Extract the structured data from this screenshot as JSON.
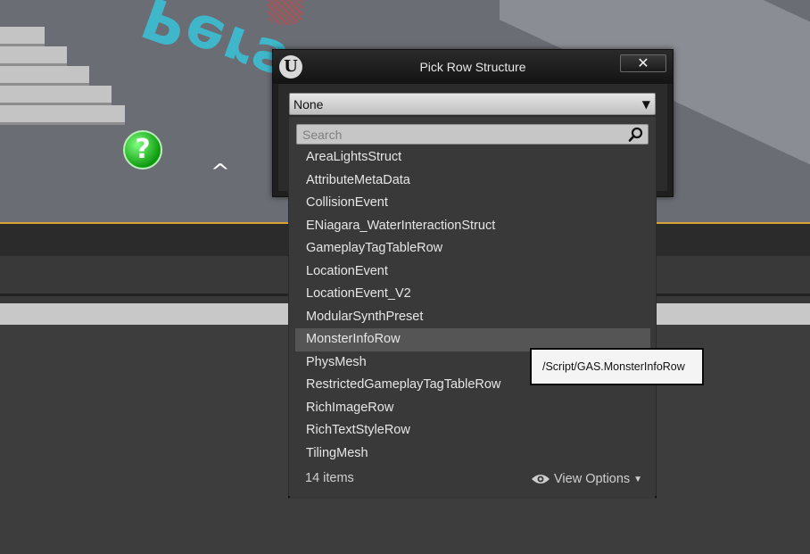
{
  "dialog": {
    "title": "Pick Row Structure",
    "close_label": "✕",
    "logo_label": "U",
    "combo_value": "None",
    "combo_arrow": "▼"
  },
  "viewport": {
    "help_symbol": "?",
    "caret_symbol": "^"
  },
  "search": {
    "placeholder": "Search"
  },
  "list": {
    "items": [
      "AreaLightsStruct",
      "AttributeMetaData",
      "CollisionEvent",
      "ENiagara_WaterInteractionStruct",
      "GameplayTagTableRow",
      "LocationEvent",
      "LocationEvent_V2",
      "ModularSynthPreset",
      "MonsterInfoRow",
      "PhysMesh",
      "RestrictedGameplayTagTableRow",
      "RichImageRow",
      "RichTextStyleRow",
      "TilingMesh"
    ],
    "hovered_index": 8
  },
  "footer": {
    "count": "14 items",
    "view_options": "View Options",
    "view_arrow": "▼"
  },
  "tooltip": {
    "text": "/Script/GAS.MonsterInfoRow"
  },
  "colors": {
    "viewport_edge": "#d9a03a",
    "hover_row": "#555555",
    "person_text": "#3fb6c9"
  }
}
